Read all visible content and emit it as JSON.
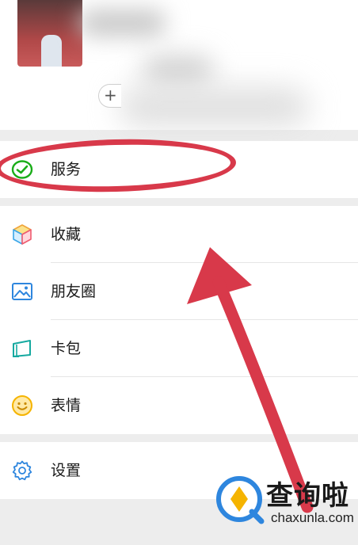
{
  "profile": {
    "status_plus": "+"
  },
  "menu": {
    "service": {
      "label": "服务",
      "icon": "service-check-icon"
    },
    "group2": [
      {
        "label": "收藏",
        "icon": "favorites-cube-icon"
      },
      {
        "label": "朋友圈",
        "icon": "moments-picture-icon"
      },
      {
        "label": "卡包",
        "icon": "card-wallet-icon"
      },
      {
        "label": "表情",
        "icon": "stickers-smiley-icon"
      }
    ],
    "settings": {
      "label": "设置",
      "icon": "settings-gear-icon"
    }
  },
  "annotation": {
    "mark_color": "#d8394a"
  },
  "watermark": {
    "brand": "查询啦",
    "domain": "chaxunla.com"
  },
  "colors": {
    "background": "#ededed",
    "card": "#ffffff",
    "accent_green": "#1aad19",
    "accent_blue": "#2e86de",
    "accent_yellow": "#f5b400"
  }
}
